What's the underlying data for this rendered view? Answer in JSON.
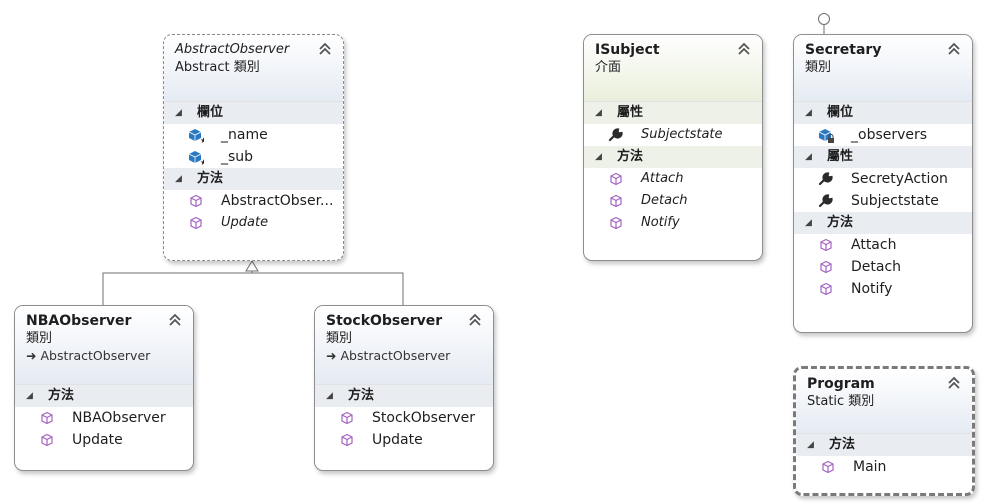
{
  "abstract_observer": {
    "name": "AbstractObserver",
    "kind": "Abstract 類別",
    "sections": [
      {
        "title": "欄位",
        "members": [
          "_name",
          "_sub"
        ]
      },
      {
        "title": "方法",
        "members": [
          "AbstractObser...",
          "Update"
        ]
      }
    ]
  },
  "isubject": {
    "name": "ISubject",
    "kind": "介面",
    "sections": [
      {
        "title": "屬性",
        "members": [
          "Subjectstate"
        ]
      },
      {
        "title": "方法",
        "members": [
          "Attach",
          "Detach",
          "Notify"
        ]
      }
    ]
  },
  "secretary": {
    "name": "Secretary",
    "kind": "類別",
    "sections": [
      {
        "title": "欄位",
        "members": [
          "_observers"
        ]
      },
      {
        "title": "屬性",
        "members": [
          "SecretyAction",
          "Subjectstate"
        ]
      },
      {
        "title": "方法",
        "members": [
          "Attach",
          "Detach",
          "Notify"
        ]
      }
    ]
  },
  "nba_observer": {
    "name": "NBAObserver",
    "kind": "類別",
    "base": "AbstractObserver",
    "sections": [
      {
        "title": "方法",
        "members": [
          "NBAObserver",
          "Update"
        ]
      }
    ]
  },
  "stock_observer": {
    "name": "StockObserver",
    "kind": "類別",
    "base": "AbstractObserver",
    "sections": [
      {
        "title": "方法",
        "members": [
          "StockObserver",
          "Update"
        ]
      }
    ]
  },
  "program": {
    "name": "Program",
    "kind": "Static 類別",
    "sections": [
      {
        "title": "方法",
        "members": [
          "Main"
        ]
      }
    ]
  },
  "colors": {
    "field_icon": "#2a78c2",
    "method_icon": "#a463c0",
    "property_icon": "#2b2b2b",
    "connector": "#6f6f6f"
  }
}
